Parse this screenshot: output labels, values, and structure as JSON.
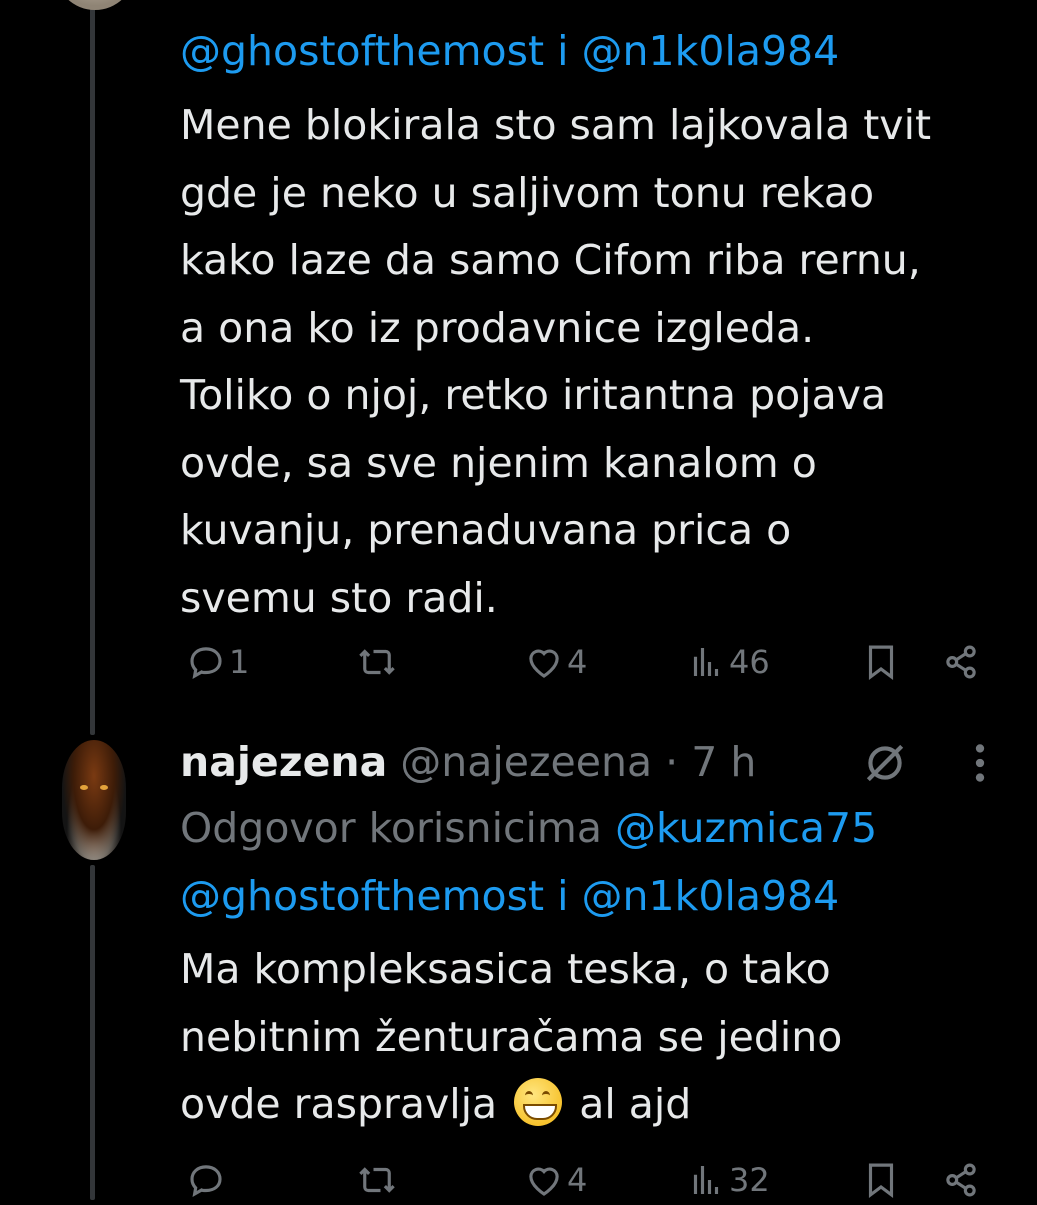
{
  "tweet1": {
    "mentions_line": "@ghostofthemost i @n1k0la984",
    "mention_a": "@ghostofthemost",
    "conj": " i ",
    "mention_b": "@n1k0la984",
    "body_lines": [
      "Mene blokirala sto sam lajkovala tvit",
      "gde je neko u saljivom tonu rekao",
      "kako laze da samo Cifom riba rernu,",
      "a ona ko iz prodavnice izgleda.",
      "Toliko o njoj, retko iritantna pojava",
      "ovde, sa sve njenim kanalom o",
      "kuvanju, prenaduvana prica o",
      "svemu sto radi."
    ],
    "stats": {
      "replies": "1",
      "retweets": "",
      "likes": "4",
      "views": "46"
    }
  },
  "tweet2": {
    "display_name": "najezena",
    "handle": "@najezeena",
    "separator": " · ",
    "time": "7 h",
    "reply_prefix": "Odgovor korisnicima ",
    "reply_mention_1": "@kuzmica75",
    "mention_a": "@ghostofthemost",
    "conj": " i ",
    "mention_b": "@n1k0la984",
    "body_line1": "Ma kompleksasica teska, o tako",
    "body_line2": "nebitnim ženturačama se jedino",
    "body_line3_before": "ovde raspravlja ",
    "emoji_name": "grinning-face-with-smiling-eyes-emoji",
    "body_line3_after": " al ajd",
    "stats": {
      "replies": "",
      "retweets": "",
      "likes": "4",
      "views": "32"
    }
  },
  "colors": {
    "background": "#000000",
    "text": "#e7e9ea",
    "link": "#1d9bf0",
    "muted": "#71767b"
  }
}
